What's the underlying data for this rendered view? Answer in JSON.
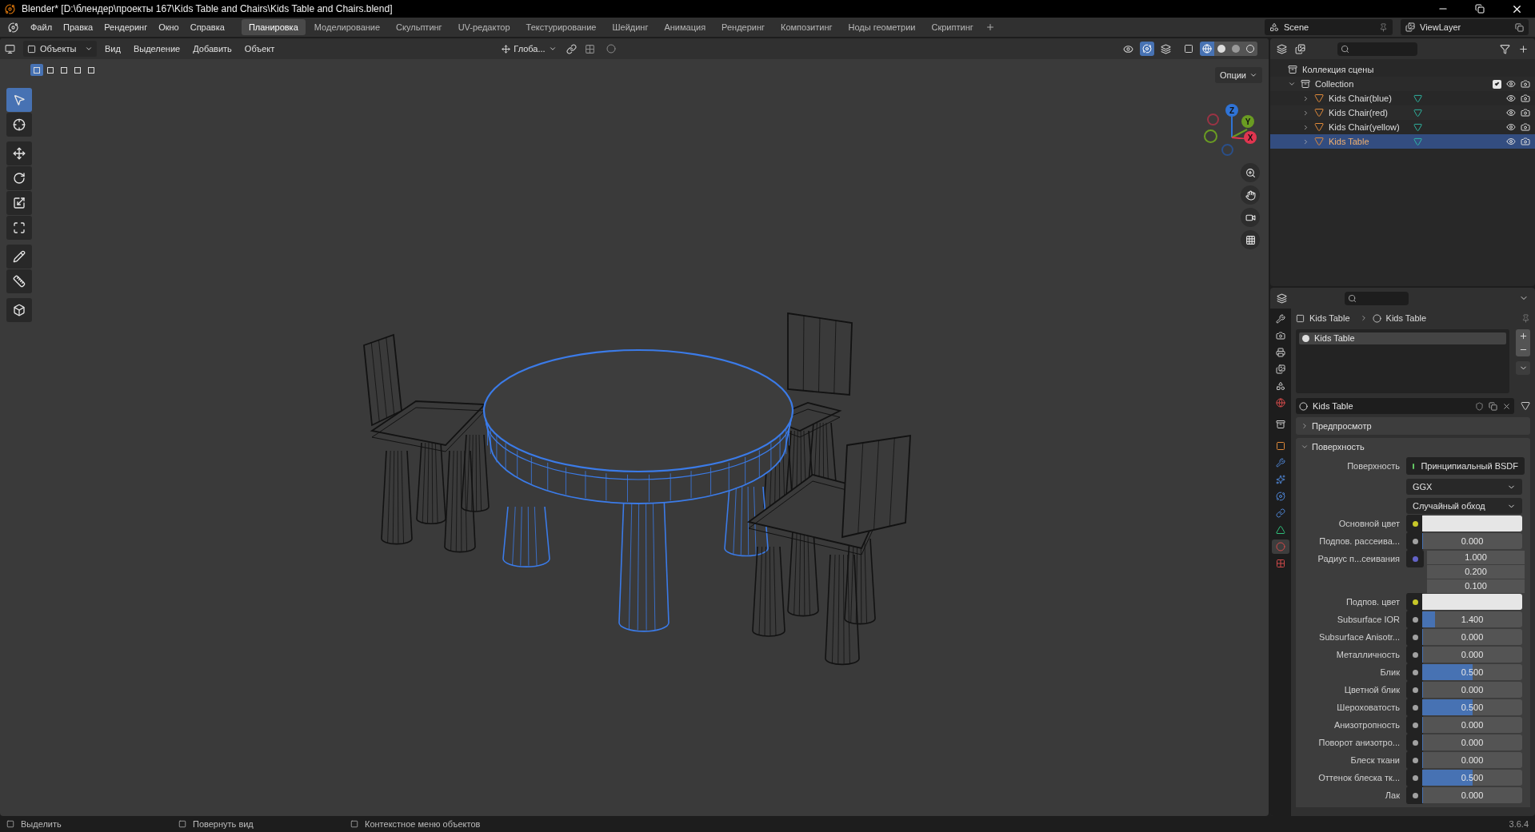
{
  "window": {
    "title": "Blender* [D:\\блендер\\проекты 167\\Kids Table and Chairs\\Kids Table and Chairs.blend]"
  },
  "menu": [
    "Файл",
    "Правка",
    "Рендеринг",
    "Окно",
    "Справка"
  ],
  "workspaces": [
    {
      "label": "Планировка",
      "selected": true
    },
    {
      "label": "Моделирование",
      "selected": false
    },
    {
      "label": "Скульптинг",
      "selected": false
    },
    {
      "label": "UV-редактор",
      "selected": false
    },
    {
      "label": "Текстурирование",
      "selected": false
    },
    {
      "label": "Шейдинг",
      "selected": false
    },
    {
      "label": "Анимация",
      "selected": false
    },
    {
      "label": "Рендеринг",
      "selected": false
    },
    {
      "label": "Композитинг",
      "selected": false
    },
    {
      "label": "Ноды геометрии",
      "selected": false
    },
    {
      "label": "Скриптинг",
      "selected": false
    }
  ],
  "scene": "Scene",
  "view_layer": "ViewLayer",
  "viewport": {
    "mode": "Объекты",
    "menus": [
      "Вид",
      "Выделение",
      "Добавить",
      "Объект"
    ],
    "orientation": "Глоба...",
    "options": "Опции",
    "select_modes": [
      {
        "selected": true
      },
      {
        "selected": false
      },
      {
        "selected": false
      },
      {
        "selected": false
      },
      {
        "selected": false
      }
    ],
    "tool_groups": [
      {
        "tools": [
          {
            "kind": "select",
            "selected": true
          },
          {
            "kind": "cursor",
            "selected": false
          }
        ]
      },
      {
        "tools": [
          {
            "kind": "move",
            "selected": false
          },
          {
            "kind": "rotate",
            "selected": false
          },
          {
            "kind": "scale",
            "selected": false
          },
          {
            "kind": "transform",
            "selected": false
          }
        ]
      },
      {
        "tools": [
          {
            "kind": "annotate",
            "selected": false
          },
          {
            "kind": "measure",
            "selected": false
          }
        ]
      },
      {
        "tools": [
          {
            "kind": "add_cube",
            "selected": false
          }
        ]
      }
    ],
    "gizmo": [
      {
        "label": "Z",
        "color": "#2f73d6"
      },
      {
        "label": "Y",
        "color": "#6a9c22"
      },
      {
        "label": "X",
        "color": "#e0354f"
      }
    ]
  },
  "outliner": {
    "root": "Коллекция сцены",
    "collection": {
      "name": "Collection",
      "checked": true,
      "expanded": true,
      "children": [
        {
          "name": "Kids Chair(blue)",
          "selected": false
        },
        {
          "name": "Kids Chair(red)",
          "selected": false
        },
        {
          "name": "Kids Chair(yellow)",
          "selected": false
        },
        {
          "name": "Kids Table",
          "selected": true
        }
      ]
    }
  },
  "properties": {
    "tabs": [
      {
        "kind": "tool",
        "selected": false
      },
      {
        "kind": "render",
        "selected": false
      },
      {
        "kind": "output",
        "selected": false
      },
      {
        "kind": "view_layer",
        "selected": false
      },
      {
        "kind": "scene",
        "selected": false
      },
      {
        "kind": "world",
        "selected": false
      },
      {
        "kind": "collection",
        "selected": false
      },
      {
        "kind": "object",
        "selected": false
      },
      {
        "kind": "modifier",
        "selected": false
      },
      {
        "kind": "particles",
        "selected": false
      },
      {
        "kind": "physics",
        "selected": false
      },
      {
        "kind": "constraints",
        "selected": false
      },
      {
        "kind": "data",
        "selected": false
      },
      {
        "kind": "material",
        "selected": true
      },
      {
        "kind": "texture",
        "selected": false
      }
    ],
    "breadcrumb": [
      "Kids Table",
      "Kids Table"
    ],
    "slots": [
      {
        "name": "Kids Table",
        "selected": true
      }
    ],
    "material": "Kids Table",
    "panels": [
      {
        "title": "Предпросмотр",
        "expanded": false
      },
      {
        "title": "Поверхность",
        "expanded": true
      }
    ],
    "rows": [
      {
        "kind": "shader",
        "label": "Поверхность",
        "value": "Принципиальный BSDF",
        "color": "#63c763"
      },
      {
        "kind": "dropdown",
        "value": "GGX"
      },
      {
        "kind": "dropdown",
        "value": "Случайный обход"
      },
      {
        "kind": "color",
        "label": "Основной цвет",
        "color": "#c7c729"
      },
      {
        "kind": "slider",
        "label": "Подпов. рассеива...",
        "value": "0.000",
        "level": 0,
        "color": "#a1a1a1"
      },
      {
        "kind": "vector",
        "label": "Радиус п...сеивания",
        "values": [
          "1.000",
          "0.200",
          "0.100"
        ],
        "color": "#6363c7"
      },
      {
        "kind": "color",
        "label": "Подпов. цвет",
        "color": "#c7c729"
      },
      {
        "kind": "slider",
        "label": "Subsurface IOR",
        "value": "1.400",
        "level": 0.13,
        "color": "#a1a1a1"
      },
      {
        "kind": "slider",
        "label": "Subsurface Anisotr...",
        "value": "0.000",
        "level": 0,
        "color": "#a1a1a1"
      },
      {
        "kind": "slider",
        "label": "Металличность",
        "value": "0.000",
        "level": 0,
        "color": "#a1a1a1"
      },
      {
        "kind": "slider",
        "label": "Блик",
        "value": "0.500",
        "level": 0.5,
        "color": "#a1a1a1"
      },
      {
        "kind": "slider",
        "label": "Цветной блик",
        "value": "0.000",
        "level": 0,
        "color": "#a1a1a1"
      },
      {
        "kind": "slider",
        "label": "Шероховатость",
        "value": "0.500",
        "level": 0.5,
        "color": "#a1a1a1"
      },
      {
        "kind": "slider",
        "label": "Анизотропность",
        "value": "0.000",
        "level": 0,
        "color": "#a1a1a1"
      },
      {
        "kind": "slider",
        "label": "Поворот анизотро...",
        "value": "0.000",
        "level": 0,
        "color": "#a1a1a1"
      },
      {
        "kind": "slider",
        "label": "Блеск ткани",
        "value": "0.000",
        "level": 0,
        "color": "#a1a1a1"
      },
      {
        "kind": "slider",
        "label": "Оттенок блеска тк...",
        "value": "0.500",
        "level": 0.5,
        "color": "#a1a1a1"
      },
      {
        "kind": "slider",
        "label": "Лак",
        "value": "0.000",
        "level": 0,
        "color": "#a1a1a1"
      }
    ]
  },
  "status_bar": {
    "hints": [
      "Выделить",
      "Повернуть вид",
      "Контекстное меню объектов"
    ],
    "version": "3.6.4"
  }
}
